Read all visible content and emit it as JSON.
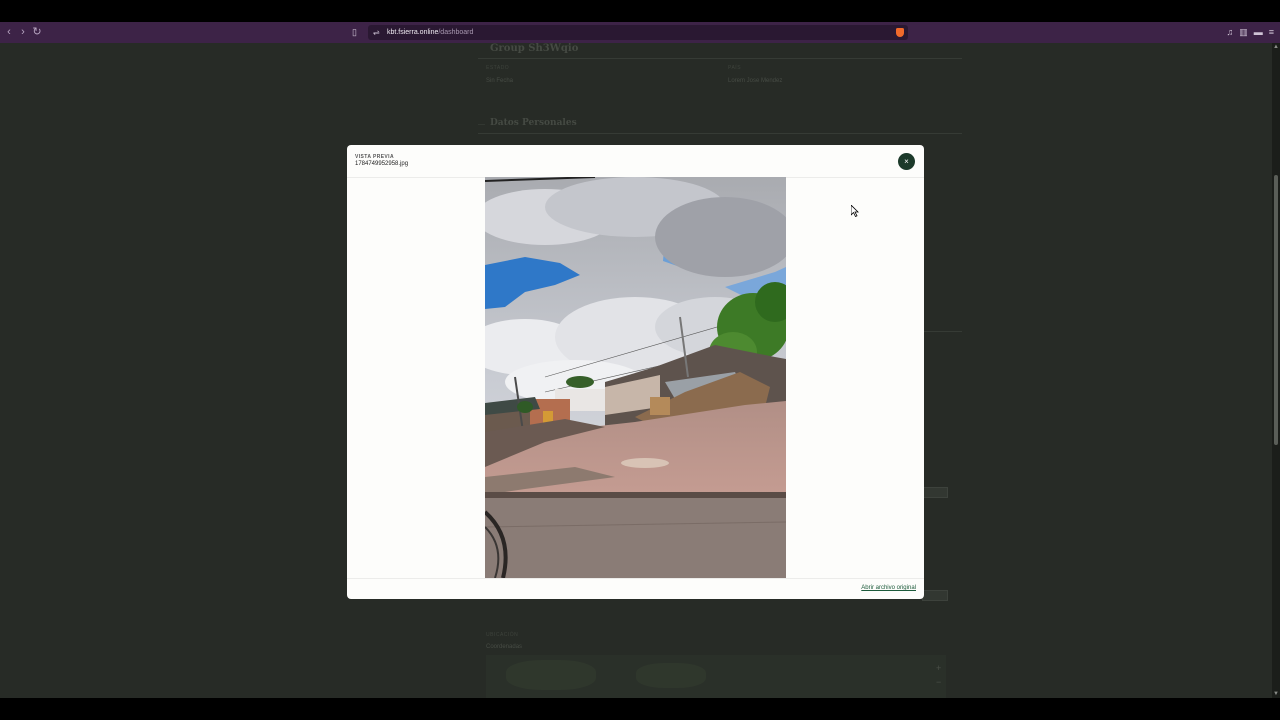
{
  "browser": {
    "url_domain": "kbt.fsierra.online",
    "url_path": "/dashboard"
  },
  "background": {
    "group_title": "Group Sh3Wqio",
    "section_title": "Datos Personales",
    "field1_label": "ESTADO",
    "field1_value": "Sin Fecha",
    "field2_label": "PAÍS",
    "field2_value": "Lorem Jose Mendez",
    "map_label": "UBICACIÓN",
    "map_sublabel": "Coordenadas"
  },
  "modal": {
    "eyebrow": "VISTA PREVIA",
    "filename": "1784749952958.jpg",
    "close_label": "×",
    "open_link": "Abrir archivo original"
  },
  "icons": {
    "back": "back-arrow-icon",
    "forward": "forward-arrow-icon",
    "reload": "reload-icon",
    "bookmark": "bookmark-icon",
    "site_info": "site-info-icon",
    "shield": "brave-shield-icon",
    "menu": "menu-icon"
  },
  "colors": {
    "toolbar": "#3d2347",
    "page_bg": "#272b26",
    "close_button": "#1c3a2a",
    "link": "#1c5a3a"
  }
}
